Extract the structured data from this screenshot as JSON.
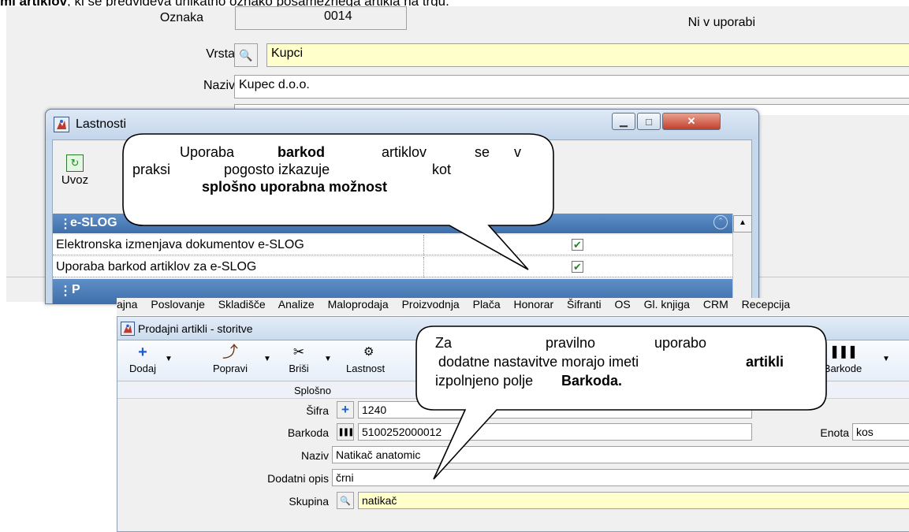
{
  "doc": {
    "top_bold": "mi artiklov",
    "top_rest": ", ki se predvideva unikatno oznako posameznega artikla na trgu."
  },
  "top_form": {
    "oznaka_label": "Oznaka",
    "oznaka_value": "0014",
    "status": "Ni v uporabi",
    "vrsta_label": "Vrsta",
    "vrsta_value": "Kupci",
    "naziv_label": "Naziv",
    "naziv_value": "Kupec d.o.o."
  },
  "lastnosti": {
    "title": "Lastnosti",
    "uvoz_label": "Uvoz",
    "group_label": "e-SLOG",
    "rows": [
      {
        "label": "Elektronska izmenjava dokumentov e-SLOG",
        "checked": true
      },
      {
        "label": "Uporaba barkod artiklov za e-SLOG",
        "checked": true
      }
    ],
    "next_group_partial": "P"
  },
  "callout1": {
    "t1": "Uporaba",
    "t2": "barkod",
    "t3": "artiklov",
    "t4": "se",
    "t5": "v",
    "t6": "praksi",
    "t7": "pogosto izkazuje",
    "t8": "kot",
    "t9": "splošno uporabna možnost"
  },
  "menu": {
    "items": [
      "ajna",
      "Poslovanje",
      "Skladišče",
      "Analize",
      "Maloprodaja",
      "Proizvodnja",
      "Plača",
      "Honorar",
      "Šifranti",
      "OS",
      "Gl. knjiga",
      "CRM",
      "Recepcija"
    ]
  },
  "artikli_window": {
    "title": "Prodajni artikli - storitve",
    "toolbar": {
      "dodaj": "Dodaj",
      "popravi": "Popravi",
      "brisi": "Briši",
      "lastnosti": "Lastnost",
      "barkode": "Barkode"
    },
    "section": "Splošno",
    "sifra_label": "Šifra",
    "sifra_value": "1240",
    "barkoda_label": "Barkoda",
    "barkoda_value": "5100252000012",
    "enota_label": "Enota",
    "enota_value": "kos",
    "naziv_label": "Naziv",
    "naziv_value": "Natikač anatomic",
    "opis_label": "Dodatni opis",
    "opis_value": "črni",
    "skupina_label": "Skupina",
    "skupina_value": "natikač"
  },
  "callout2": {
    "t1": "Za",
    "t2": "pravilno",
    "t3": "uporabo",
    "t4": "dodatne nastavitve morajo imeti",
    "t5": "artikli",
    "t6": "izpolnjeno polje",
    "t7": "Barkoda."
  },
  "colors": {
    "yellow_field": "#ffffcc",
    "group_header": "#4a7ab8",
    "close_button": "#c94a32",
    "check_green": "#1b8a1b"
  }
}
